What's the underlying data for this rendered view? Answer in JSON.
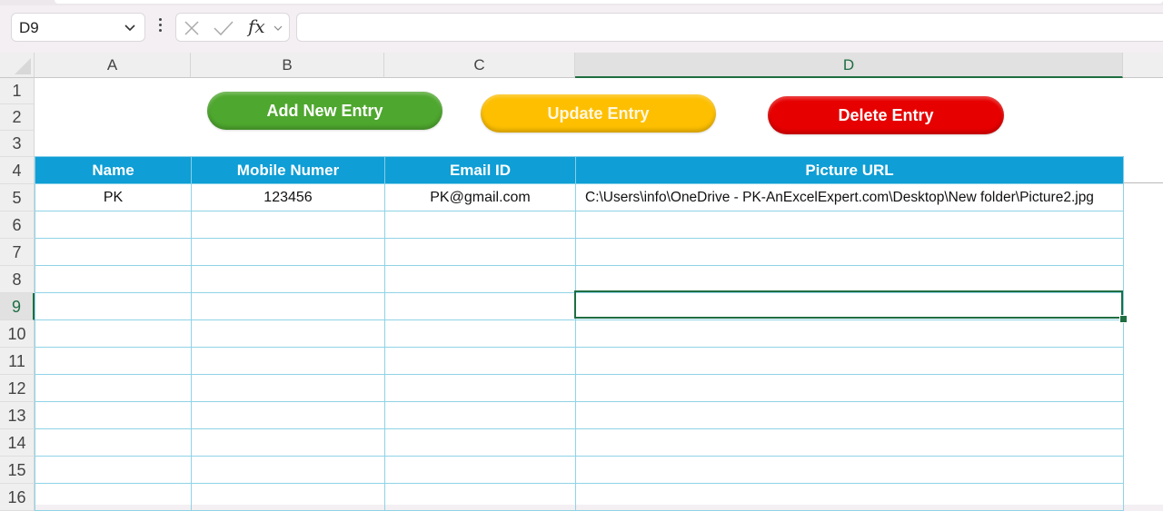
{
  "formula_bar": {
    "name_box": "D9",
    "fx_label": "fx",
    "formula_value": ""
  },
  "columns": [
    {
      "label": "A",
      "selected": false
    },
    {
      "label": "B",
      "selected": false
    },
    {
      "label": "C",
      "selected": false
    },
    {
      "label": "D",
      "selected": true
    }
  ],
  "rows": [
    "1",
    "2",
    "3",
    "4",
    "5",
    "6",
    "7",
    "8",
    "9",
    "10",
    "11",
    "12",
    "13",
    "14",
    "15",
    "16"
  ],
  "selected_row": "9",
  "buttons": {
    "add": {
      "label": "Add New Entry",
      "color": "#4ea72e"
    },
    "update": {
      "label": "Update Entry",
      "color": "#fdbf00"
    },
    "delete": {
      "label": "Delete Entry",
      "color": "#e60000"
    }
  },
  "table": {
    "header_color": "#0f9ed5",
    "headers": [
      "Name",
      "Mobile Numer",
      "Email ID",
      "Picture URL"
    ],
    "rows": [
      [
        "PK",
        "123456",
        "PK@gmail.com",
        "C:\\Users\\info\\OneDrive - PK-AnExcelExpert.com\\Desktop\\New folder\\Picture2.jpg"
      ],
      [
        "",
        "",
        "",
        ""
      ],
      [
        "",
        "",
        "",
        ""
      ],
      [
        "",
        "",
        "",
        ""
      ],
      [
        "",
        "",
        "",
        ""
      ],
      [
        "",
        "",
        "",
        ""
      ],
      [
        "",
        "",
        "",
        ""
      ],
      [
        "",
        "",
        "",
        ""
      ],
      [
        "",
        "",
        "",
        ""
      ],
      [
        "",
        "",
        "",
        ""
      ],
      [
        "",
        "",
        "",
        ""
      ],
      [
        "",
        "",
        "",
        ""
      ]
    ]
  },
  "selection_color": "#1e6e42"
}
